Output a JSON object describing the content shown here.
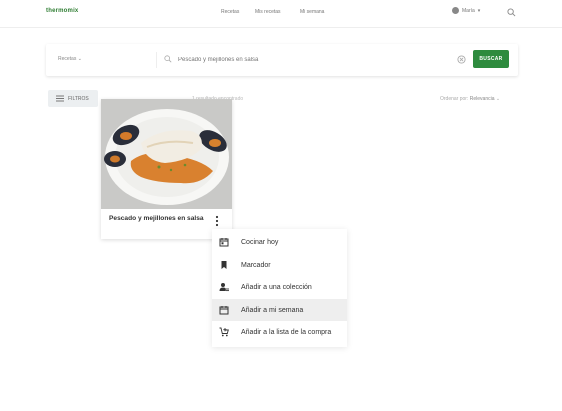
{
  "header": {
    "logo": "thermomix",
    "nav": [
      "Recetas",
      "Mis recetas",
      "Mi semana"
    ],
    "user_label": "María"
  },
  "search": {
    "select_label": "Recetas",
    "placeholder": "Pescado y mejillones en salsa",
    "button_label": "BUSCAR"
  },
  "filters": {
    "button_label": "FILTROS",
    "count_text": "1 resultado encontrado",
    "sort_label": "Ordenar por:",
    "sort_value": "Relevancia"
  },
  "card": {
    "title": "Pescado y mejillones en salsa"
  },
  "context_menu": {
    "items": [
      {
        "label": "Cocinar hoy",
        "icon": "calendar-today-icon"
      },
      {
        "label": "Marcador",
        "icon": "bookmark-icon"
      },
      {
        "label": "Añadir a una colección",
        "icon": "add-to-collection-icon"
      },
      {
        "label": "Añadir a mi semana",
        "icon": "calendar-icon"
      },
      {
        "label": "Añadir a la lista de la compra",
        "icon": "add-to-cart-icon"
      }
    ],
    "highlighted_index": 3
  },
  "colors": {
    "brand": "#2e7d32",
    "button": "#2e8b3e",
    "menu_highlight": "#eeeeee"
  }
}
